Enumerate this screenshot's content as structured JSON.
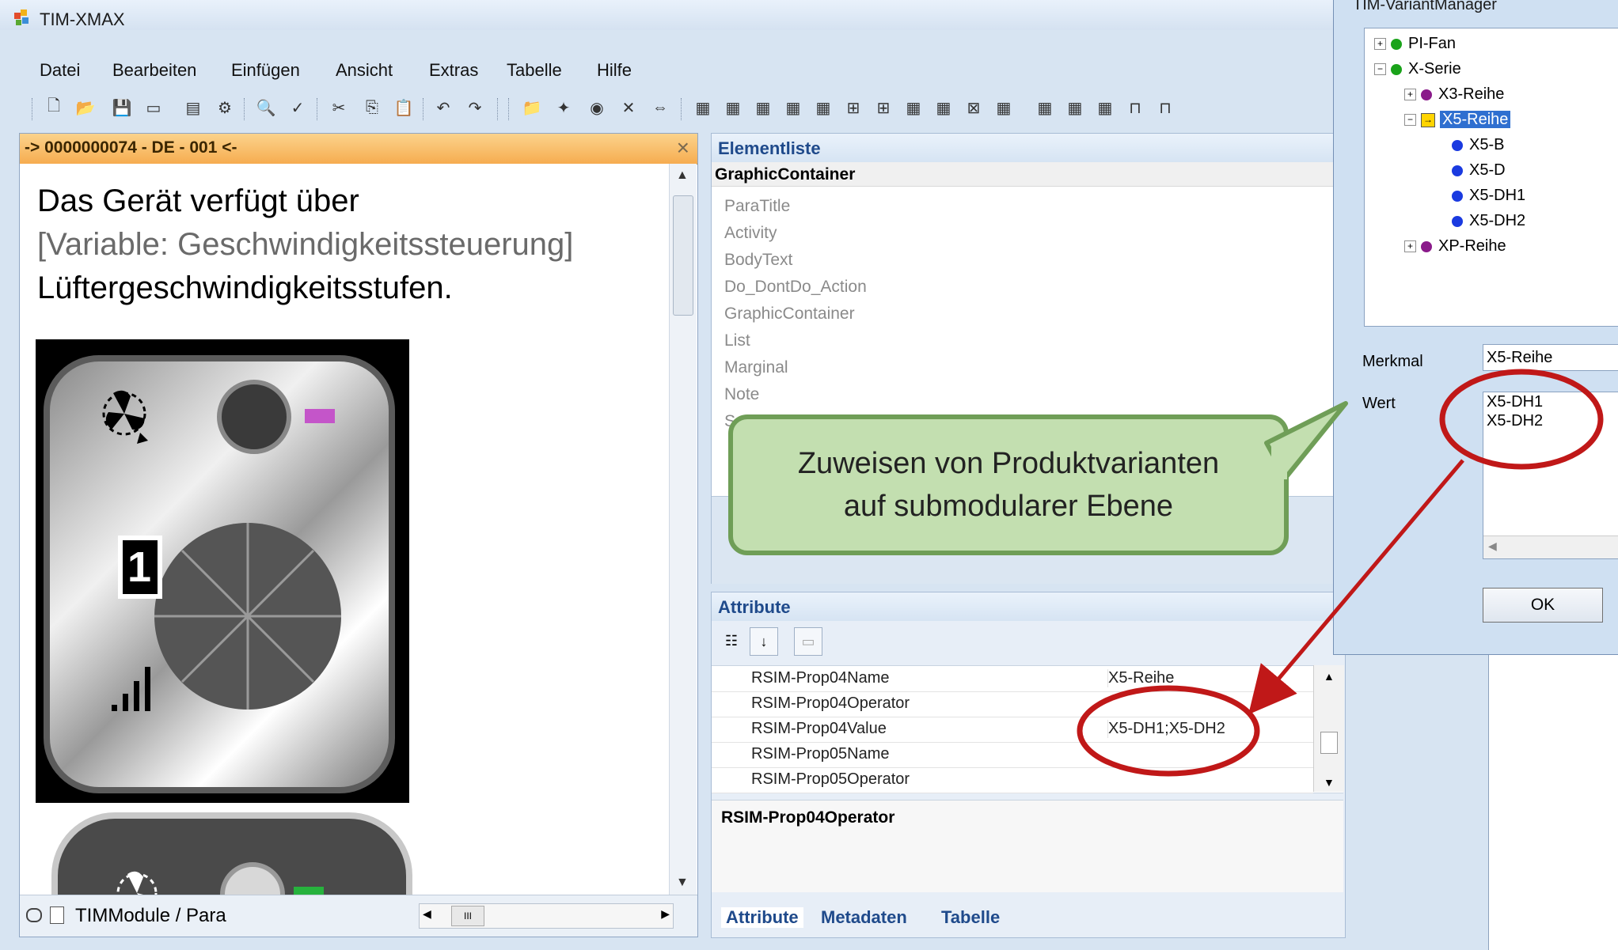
{
  "app": {
    "title": "TIM-XMAX",
    "logo_icon": "tim-logo-icon"
  },
  "menu": [
    "Datei",
    "Bearbeiten",
    "Einfügen",
    "Ansicht",
    "Extras",
    "Tabelle",
    "Hilfe"
  ],
  "document": {
    "header": "-> 0000000074 - DE - 001 <-",
    "line1": "Das Gerät verfügt über",
    "variable": "[Variable: Geschwindigkeitssteuerung]",
    "line3": "Lüftergeschwindigkeitsstufen.",
    "speed_digit": "1",
    "breadcrumb": "TIMModule / Para",
    "scroll_mark": "III"
  },
  "element_list": {
    "title": "Elementliste",
    "selected": "GraphicContainer",
    "items": [
      "ParaTitle",
      "Activity",
      "BodyText",
      "Do_DontDo_Action",
      "GraphicContainer",
      "List",
      "Marginal",
      "Note",
      "S"
    ]
  },
  "attributes": {
    "title": "Attribute",
    "rows": [
      {
        "name": "RSIM-Prop04Name",
        "value": "X5-Reihe"
      },
      {
        "name": "RSIM-Prop04Operator",
        "value": ""
      },
      {
        "name": "RSIM-Prop04Value",
        "value": "X5-DH1;X5-DH2"
      },
      {
        "name": "RSIM-Prop05Name",
        "value": ""
      },
      {
        "name": "RSIM-Prop05Operator",
        "value": ""
      }
    ],
    "description": "RSIM-Prop04Operator",
    "tabs": [
      "Attribute",
      "Metadaten",
      "Tabelle"
    ]
  },
  "variant_manager": {
    "title": "TIM-VariantManager",
    "tree": [
      {
        "label": "PI-Fan",
        "level": 0,
        "expander": "+",
        "dot": "#1aa31a"
      },
      {
        "label": "X-Serie",
        "level": 0,
        "expander": "-",
        "dot": "#1aa31a"
      },
      {
        "label": "X3-Reihe",
        "level": 1,
        "expander": "+",
        "dot": "#8a1a8a"
      },
      {
        "label": "X5-Reihe",
        "level": 1,
        "expander": "-",
        "dot": "arrow",
        "selected": true
      },
      {
        "label": "X5-B",
        "level": 2,
        "expander": "",
        "dot": "#1a3ae0"
      },
      {
        "label": "X5-D",
        "level": 2,
        "expander": "",
        "dot": "#1a3ae0"
      },
      {
        "label": "X5-DH1",
        "level": 2,
        "expander": "",
        "dot": "#1a3ae0"
      },
      {
        "label": "X5-DH2",
        "level": 2,
        "expander": "",
        "dot": "#1a3ae0"
      },
      {
        "label": "XP-Reihe",
        "level": 1,
        "expander": "+",
        "dot": "#8a1a8a"
      }
    ],
    "merkmal_label": "Merkmal",
    "merkmal_value": "X5-Reihe",
    "wert_label": "Wert",
    "wert_values": [
      "X5-DH1",
      "X5-DH2"
    ],
    "ok_label": "OK"
  },
  "callout": {
    "line1": "Zuweisen von Produktvarianten",
    "line2": "auf submodularer Ebene"
  },
  "colors": {
    "highlight_circle": "#c01818",
    "callout_fill": "#c3dfb0",
    "callout_border": "#6f9e57",
    "selection": "#2f6fd0"
  }
}
